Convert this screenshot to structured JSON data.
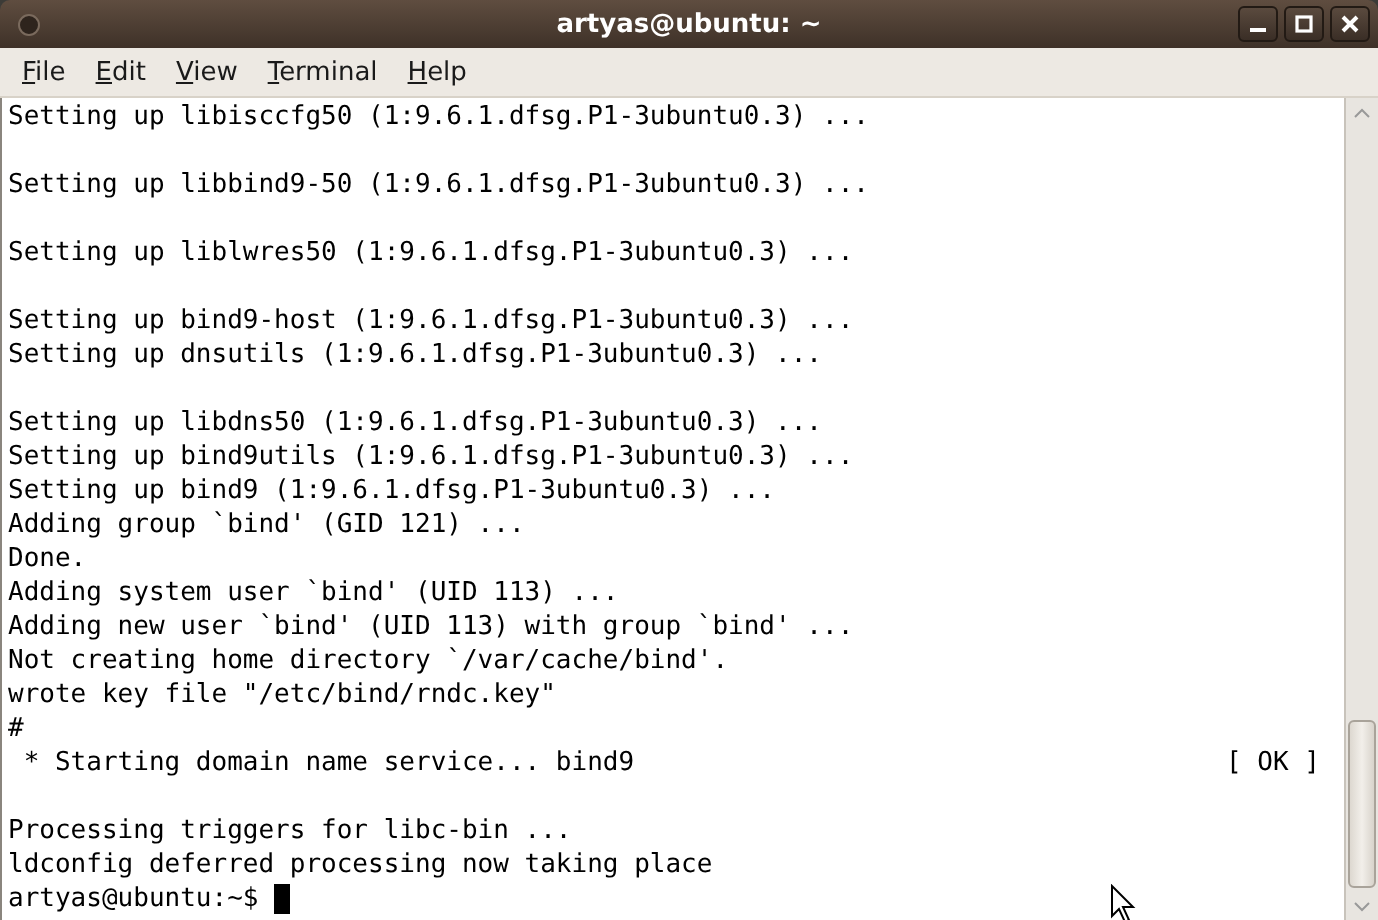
{
  "window": {
    "title": "artyas@ubuntu: ~"
  },
  "menu": [
    "File",
    "Edit",
    "View",
    "Terminal",
    "Help"
  ],
  "terminal": {
    "lines": [
      {
        "kind": "text",
        "text": "Setting up libisccfg50 (1:9.6.1.dfsg.P1-3ubuntu0.3) ..."
      },
      {
        "kind": "blank"
      },
      {
        "kind": "text",
        "text": "Setting up libbind9-50 (1:9.6.1.dfsg.P1-3ubuntu0.3) ..."
      },
      {
        "kind": "blank"
      },
      {
        "kind": "text",
        "text": "Setting up liblwres50 (1:9.6.1.dfsg.P1-3ubuntu0.3) ..."
      },
      {
        "kind": "blank"
      },
      {
        "kind": "text",
        "text": "Setting up bind9-host (1:9.6.1.dfsg.P1-3ubuntu0.3) ..."
      },
      {
        "kind": "text",
        "text": "Setting up dnsutils (1:9.6.1.dfsg.P1-3ubuntu0.3) ..."
      },
      {
        "kind": "blank"
      },
      {
        "kind": "text",
        "text": "Setting up libdns50 (1:9.6.1.dfsg.P1-3ubuntu0.3) ..."
      },
      {
        "kind": "text",
        "text": "Setting up bind9utils (1:9.6.1.dfsg.P1-3ubuntu0.3) ..."
      },
      {
        "kind": "text",
        "text": "Setting up bind9 (1:9.6.1.dfsg.P1-3ubuntu0.3) ..."
      },
      {
        "kind": "text",
        "text": "Adding group `bind' (GID 121) ..."
      },
      {
        "kind": "text",
        "text": "Done."
      },
      {
        "kind": "text",
        "text": "Adding system user `bind' (UID 113) ..."
      },
      {
        "kind": "text",
        "text": "Adding new user `bind' (UID 113) with group `bind' ..."
      },
      {
        "kind": "text",
        "text": "Not creating home directory `/var/cache/bind'."
      },
      {
        "kind": "text",
        "text": "wrote key file \"/etc/bind/rndc.key\""
      },
      {
        "kind": "text",
        "text": "#"
      },
      {
        "kind": "status",
        "text": " * Starting domain name service... bind9",
        "status": "[ OK ]"
      },
      {
        "kind": "blank"
      },
      {
        "kind": "text",
        "text": "Processing triggers for libc-bin ..."
      },
      {
        "kind": "text",
        "text": "ldconfig deferred processing now taking place"
      },
      {
        "kind": "prompt",
        "text": "artyas@ubuntu:~$"
      }
    ]
  }
}
